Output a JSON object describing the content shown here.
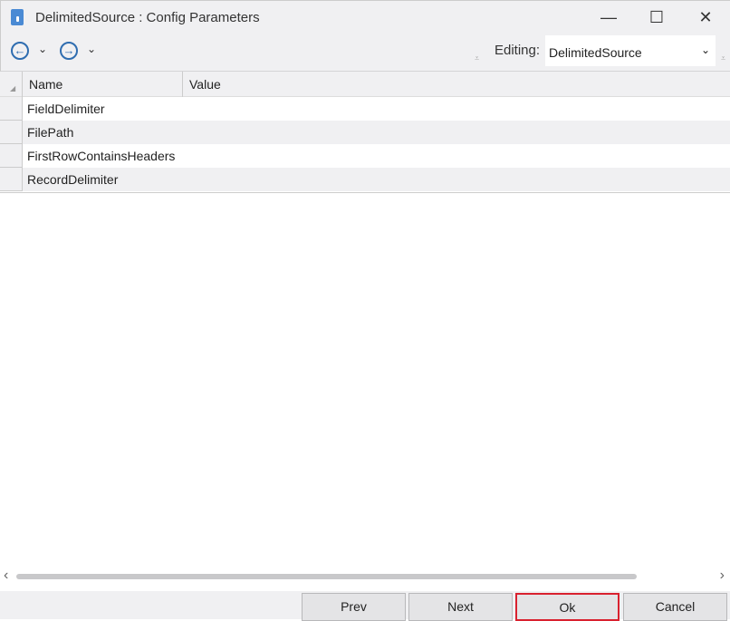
{
  "window": {
    "title": "DelimitedSource : Config Parameters",
    "minimize": "—",
    "maximize": "☐",
    "close": "✕"
  },
  "toolbar": {
    "back": "←",
    "forward": "→",
    "chevron": "⌄",
    "grip": "⩡",
    "editing_label": "Editing:",
    "editing_value": "DelimitedSource",
    "dropdown_arrow": "⌄"
  },
  "grid": {
    "columns": [
      "Name",
      "Value"
    ],
    "sort_glyph": "◢",
    "rows": [
      {
        "name": "FieldDelimiter",
        "value": ""
      },
      {
        "name": "FilePath",
        "value": ""
      },
      {
        "name": "FirstRowContainsHeaders",
        "value": ""
      },
      {
        "name": "RecordDelimiter",
        "value": ""
      }
    ]
  },
  "scroll": {
    "left": "‹",
    "right": "›"
  },
  "buttons": {
    "prev": "Prev",
    "next": "Next",
    "ok": "Ok",
    "cancel": "Cancel"
  }
}
